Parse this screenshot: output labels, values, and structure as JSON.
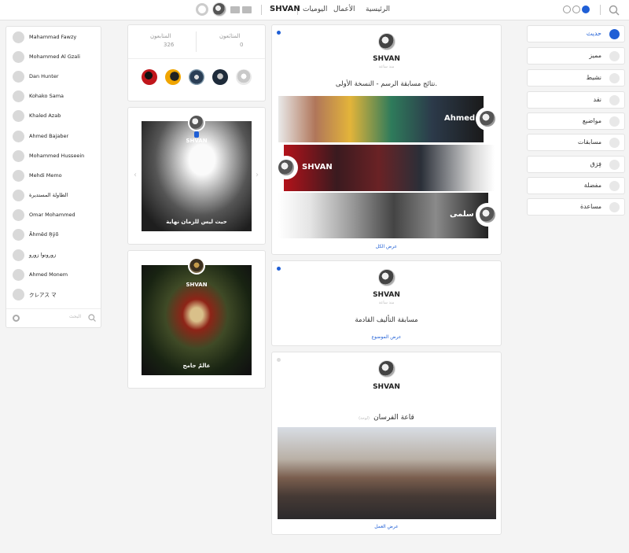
{
  "topbar": {
    "brand": "SHVAN",
    "nav": [
      "الرئيسية",
      "الأعمال",
      "اليوميات"
    ]
  },
  "users": [
    "Mahammad Fawzy",
    "Mohammed Al Gzali",
    "Dan Hunter",
    "Kohako Sama",
    "Khaled Azab",
    "Ahmed Bajaber",
    "Mohammed Husseein",
    "Mehdi Memo",
    "الطاولة المستديرة",
    "Omar Mohammed",
    "Ăhmëd Ŗÿõ",
    "زورونوا زورو",
    "Ahmed Monem",
    "クレアス マ"
  ],
  "userlist_search_placeholder": "البحث",
  "stats": {
    "following_label": "المتابَعون",
    "following_value": "0",
    "followers_label": "المتابعون",
    "followers_value": "326"
  },
  "gallery": [
    {
      "name": "SHVAN",
      "caption": "حيث ليس للزمان نهاية"
    },
    {
      "name": "SHVAN",
      "caption": "عالمٌ جامح"
    }
  ],
  "posts": [
    {
      "author": "SHVAN",
      "subtitle": "منذ ساعة",
      "title": "نتائج مسابقة الرسم - النسخة الأولى.",
      "banners": [
        "Ahmed",
        "SHVAN",
        "سلمى"
      ],
      "link": "عرض الكل"
    },
    {
      "author": "SHVAN",
      "subtitle": "منذ ساعة",
      "title": "مسابقة التأليف القادمة",
      "link": "عرض الموضوع"
    },
    {
      "author": "SHVAN",
      "title": "قاعة الفرسان",
      "tag": "(لوحة)",
      "link": "عرض العمل"
    }
  ],
  "categories": [
    "حديث",
    "مميز",
    "نشيط",
    "نقد",
    "مواضيع",
    "مسابقات",
    "فِرَق",
    "مفضلة",
    "مساعدة"
  ],
  "colors": {
    "accent": "#1f5fd6"
  }
}
